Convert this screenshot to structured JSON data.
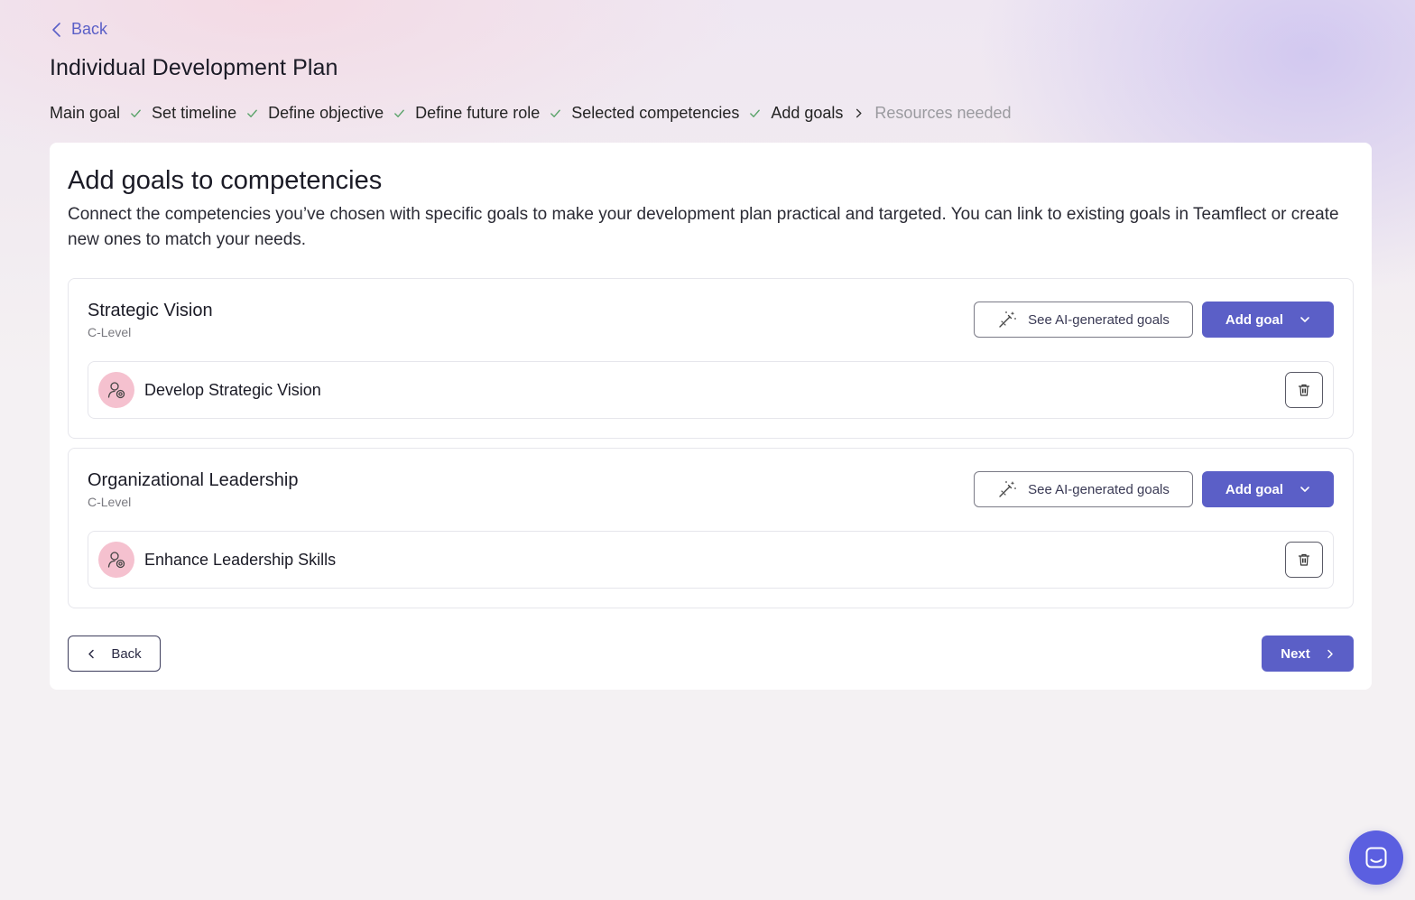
{
  "header": {
    "back_label": "Back",
    "title": "Individual Development Plan"
  },
  "steps": [
    {
      "label": "Main goal",
      "state": "done"
    },
    {
      "label": "Set timeline",
      "state": "done"
    },
    {
      "label": "Define objective",
      "state": "done"
    },
    {
      "label": "Define future role",
      "state": "done"
    },
    {
      "label": "Selected competencies",
      "state": "done"
    },
    {
      "label": "Add goals",
      "state": "current"
    },
    {
      "label": "Resources needed",
      "state": "upcoming"
    }
  ],
  "main": {
    "title": "Add goals to competencies",
    "description": "Connect the competencies you’ve chosen with specific goals to make your development plan practical and targeted. You can link to existing goals in Teamflect or create new ones to match your needs.",
    "competencies": [
      {
        "name": "Strategic Vision",
        "level": "C-Level",
        "ai_button_label": "See AI-generated goals",
        "add_button_label": "Add goal",
        "goals": [
          {
            "title": "Develop Strategic Vision"
          }
        ]
      },
      {
        "name": "Organizational Leadership",
        "level": "C-Level",
        "ai_button_label": "See AI-generated goals",
        "add_button_label": "Add goal",
        "goals": [
          {
            "title": "Enhance Leadership Skills"
          }
        ]
      }
    ],
    "footer": {
      "back_label": "Back",
      "next_label": "Next"
    }
  },
  "colors": {
    "accent": "#5b5fc7",
    "check": "#5aa36a",
    "avatar_bg": "#f5c1cf",
    "chat_launcher": "#5b5fe0"
  },
  "icons": {
    "back": "chevron-left-icon",
    "step_done": "check-icon",
    "step_current": "chevron-right-icon",
    "ai": "magic-wand-icon",
    "dropdown": "chevron-down-icon",
    "goal": "person-target-icon",
    "delete": "trash-icon",
    "chat": "chat-icon"
  }
}
